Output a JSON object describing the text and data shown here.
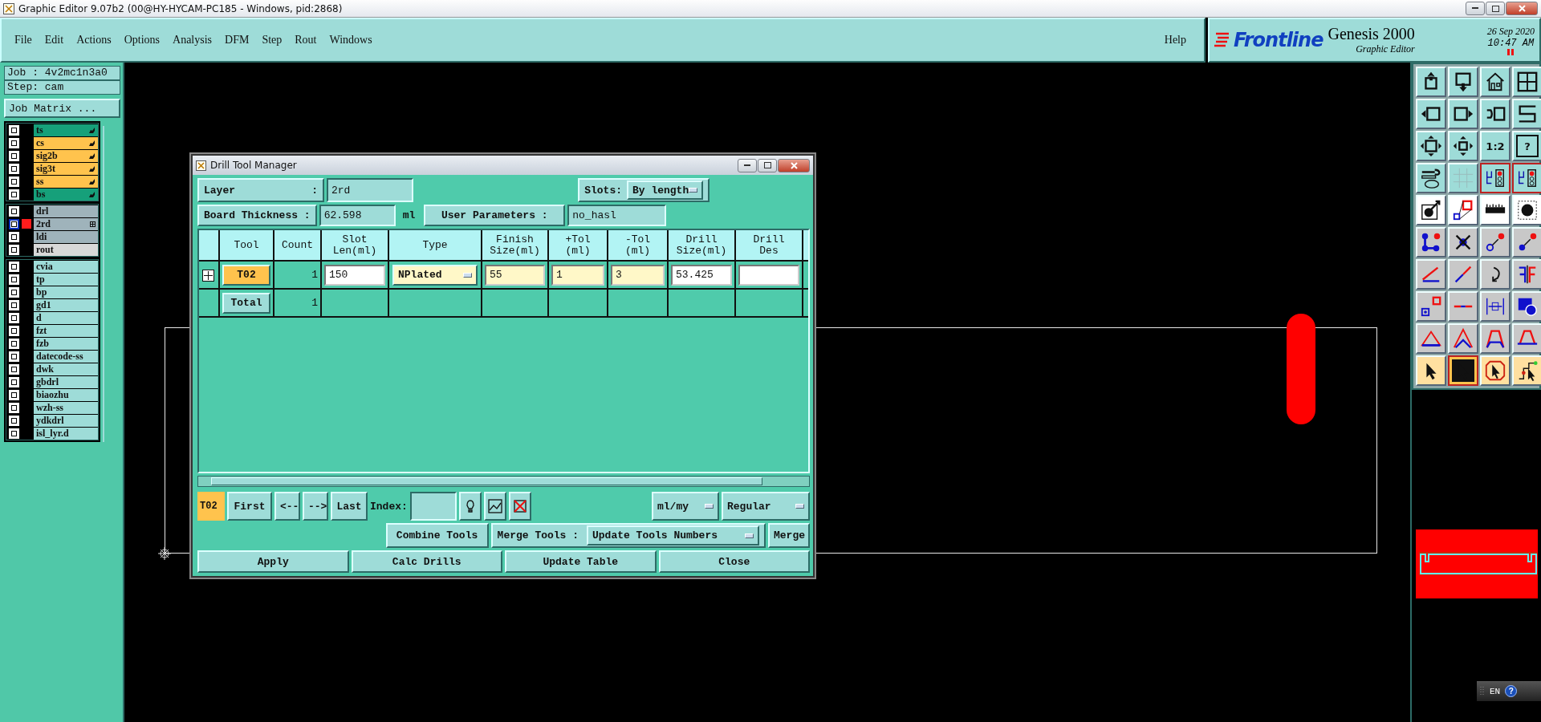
{
  "title_bar": {
    "title": "Graphic Editor 9.07b2 (00@HY-HYCAM-PC185 - Windows, pid:2868)"
  },
  "menu": [
    {
      "label": "File"
    },
    {
      "label": "Edit"
    },
    {
      "label": "Actions"
    },
    {
      "label": "Options"
    },
    {
      "label": "Analysis"
    },
    {
      "label": "DFM"
    },
    {
      "label": "Step"
    },
    {
      "label": "Rout"
    },
    {
      "label": "Windows"
    }
  ],
  "help": "Help",
  "brand": {
    "logo": "Frontline",
    "product": "Genesis 2000",
    "subtitle": "Graphic Editor",
    "date": "26 Sep 2020",
    "time": "10:47 AM"
  },
  "job_panel": {
    "job": "Job : 4v2mc1n3a0",
    "step": "Step: cam",
    "matrix_button": "Job Matrix ..."
  },
  "layer_groups": [
    {
      "layers": [
        {
          "name": "ts",
          "kind": "board",
          "color": "#16a07a",
          "selected": false,
          "displayed": false
        },
        {
          "name": "cs",
          "kind": "board",
          "color": "#ffc34d",
          "selected": false,
          "displayed": false
        },
        {
          "name": "sig2b",
          "kind": "board",
          "color": "#ffc34d",
          "selected": false,
          "displayed": false
        },
        {
          "name": "sig3t",
          "kind": "board",
          "color": "#ffc34d",
          "selected": false,
          "displayed": false
        },
        {
          "name": "ss",
          "kind": "board",
          "color": "#ffc34d",
          "selected": false,
          "displayed": false
        },
        {
          "name": "bs",
          "kind": "board",
          "color": "#16a07a",
          "selected": false,
          "displayed": false
        }
      ]
    },
    {
      "layers": [
        {
          "name": "drl",
          "kind": "misc",
          "color": "#9fb3bb",
          "selected": false,
          "displayed": false
        },
        {
          "name": "2rd",
          "kind": "misc",
          "color": "#9fb3bb",
          "selected": true,
          "displayed": true
        },
        {
          "name": "ldi",
          "kind": "misc",
          "color": "#9fb3bb",
          "selected": false,
          "displayed": false
        },
        {
          "name": "rout",
          "kind": "misc",
          "color": "#d8d8d8",
          "selected": false,
          "displayed": false
        }
      ]
    },
    {
      "layers": [
        {
          "name": "cvia",
          "kind": "misc",
          "color": "#9edcd8",
          "selected": false,
          "displayed": false
        },
        {
          "name": "tp",
          "kind": "misc",
          "color": "#9edcd8",
          "selected": false,
          "displayed": false
        },
        {
          "name": "bp",
          "kind": "misc",
          "color": "#9edcd8",
          "selected": false,
          "displayed": false
        },
        {
          "name": "gd1",
          "kind": "misc",
          "color": "#9edcd8",
          "selected": false,
          "displayed": false
        },
        {
          "name": "d",
          "kind": "misc",
          "color": "#9edcd8",
          "selected": false,
          "displayed": false
        },
        {
          "name": "fzt",
          "kind": "misc",
          "color": "#9edcd8",
          "selected": false,
          "displayed": false
        },
        {
          "name": "fzb",
          "kind": "misc",
          "color": "#9edcd8",
          "selected": false,
          "displayed": false
        },
        {
          "name": "datecode-ss",
          "kind": "misc",
          "color": "#9edcd8",
          "selected": false,
          "displayed": false
        },
        {
          "name": "dwk",
          "kind": "misc",
          "color": "#9edcd8",
          "selected": false,
          "displayed": false
        },
        {
          "name": "gbdrl",
          "kind": "misc",
          "color": "#9edcd8",
          "selected": false,
          "displayed": false
        },
        {
          "name": "biaozhu",
          "kind": "misc",
          "color": "#9edcd8",
          "selected": false,
          "displayed": false
        },
        {
          "name": "wzh-ss",
          "kind": "misc",
          "color": "#9edcd8",
          "selected": false,
          "displayed": false
        },
        {
          "name": "ydkdrl",
          "kind": "misc",
          "color": "#9edcd8",
          "selected": false,
          "displayed": false
        },
        {
          "name": "isl_lyr.d",
          "kind": "misc",
          "color": "#9edcd8",
          "selected": false,
          "displayed": false
        }
      ]
    }
  ],
  "dialog": {
    "title": "Drill Tool Manager",
    "layer_label": "Layer",
    "layer_colon": ":",
    "layer_value": "2rd",
    "slots_label": "Slots:",
    "slots_value": "By length",
    "thickness_label": "Board Thickness :",
    "thickness_value": "62.598",
    "thickness_unit": "ml",
    "user_params_button": "User Parameters :",
    "user_params_value": "no_hasl",
    "columns": [
      {
        "label": "Tool"
      },
      {
        "label": "Count"
      },
      {
        "label": "Slot\nLen(ml)"
      },
      {
        "label": "Type"
      },
      {
        "label": "Finish\nSize(ml)"
      },
      {
        "label": "+Tol\n(ml)"
      },
      {
        "label": "-Tol\n(ml)"
      },
      {
        "label": "Drill\nSize(ml)"
      },
      {
        "label": "Drill\nDes"
      }
    ],
    "rows": [
      {
        "tool": "T02",
        "selected": true,
        "count": "1",
        "slot_len": "150",
        "type": "NPlated",
        "finish": "55",
        "plus_tol": "1",
        "minus_tol": "3",
        "drill_size": "53.425"
      }
    ],
    "total": {
      "label": "Total",
      "count": "1"
    },
    "current_tool": "T02",
    "nav_buttons": [
      "First",
      "<--",
      "-->",
      "Last"
    ],
    "index_label": "Index:",
    "unit_value": "ml/my",
    "mode_value": "Regular",
    "combine_button": "Combine Tools",
    "merge_label": "Merge Tools :",
    "merge_value": "Update Tools Numbers",
    "merge_button": "Merge",
    "actions": [
      "Apply",
      "Calc Drills",
      "Update Table",
      "Close"
    ]
  },
  "palette_texts": {
    "ratio": "1:2",
    "help": "?"
  },
  "select_modes": [
    {
      "selected": false
    },
    {
      "selected": true
    },
    {
      "selected": false
    },
    {
      "selected": false
    }
  ],
  "language_bar": {
    "language": "EN",
    "help": "?"
  }
}
